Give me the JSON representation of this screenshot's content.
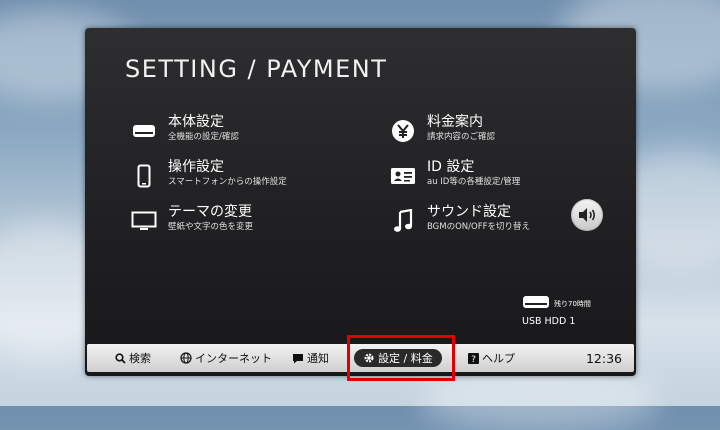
{
  "title": "SETTING / PAYMENT",
  "menu": [
    {
      "name": "本体設定",
      "sub": "全機能の設定/確認",
      "icon": "device-icon"
    },
    {
      "name": "操作設定",
      "sub": "スマートフォンからの操作設定",
      "icon": "smartphone-icon"
    },
    {
      "name": "テーマの変更",
      "sub": "壁紙や文字の色を変更",
      "icon": "monitor-icon"
    },
    {
      "name": "料金案内",
      "sub": "請求内容のご確認",
      "icon": "yen-icon"
    },
    {
      "name": "ID 設定",
      "sub": "au ID等の各種設定/管理",
      "icon": "id-card-icon"
    },
    {
      "name": "サウンド設定",
      "sub": "BGMのON/OFFを切り替え",
      "icon": "music-note-icon"
    }
  ],
  "hdd": {
    "remaining": "残り70時間",
    "label": "USB HDD 1"
  },
  "bottom_bar": {
    "search": "検索",
    "internet": "インターネット",
    "notify": "通知",
    "settings": "設定 / 料金",
    "help": "ヘルプ",
    "clock": "12:36"
  },
  "colors": {
    "highlight": "#e00000",
    "panel": "#222224"
  }
}
